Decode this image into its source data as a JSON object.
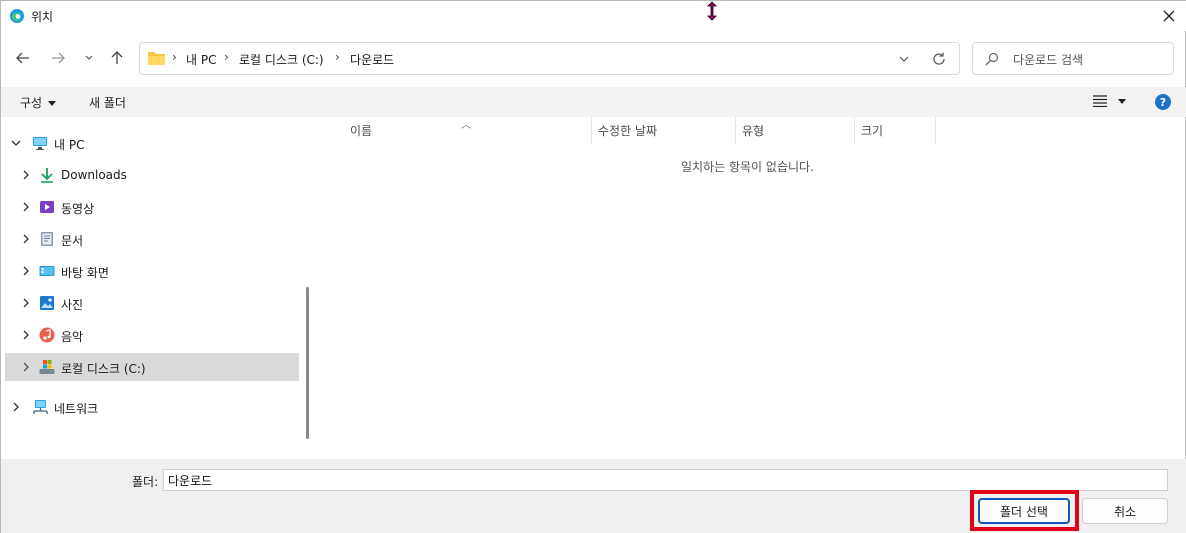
{
  "window": {
    "title": "위치",
    "close_glyph": "✕"
  },
  "toolbar": {
    "back_icon": "arrow-left-icon",
    "forward_icon": "arrow-right-icon",
    "recent_icon": "chevron-down-icon",
    "up_icon": "arrow-up-icon"
  },
  "address": {
    "crumbs": [
      "내 PC",
      "로컬 디스크 (C:)",
      "다운로드"
    ],
    "separator": "›"
  },
  "search": {
    "placeholder": "다운로드 검색"
  },
  "commandbar": {
    "organize_label": "구성",
    "new_folder_label": "새 폴더",
    "help_glyph": "?"
  },
  "navpane": {
    "items": [
      {
        "label": "내 PC",
        "icon": "pc-icon"
      },
      {
        "label": "Downloads",
        "icon": "download-icon"
      },
      {
        "label": "동영상",
        "icon": "video-icon"
      },
      {
        "label": "문서",
        "icon": "document-icon"
      },
      {
        "label": "바탕 화면",
        "icon": "desktop-icon"
      },
      {
        "label": "사진",
        "icon": "picture-icon"
      },
      {
        "label": "음악",
        "icon": "music-icon"
      },
      {
        "label": "로컬 디스크 (C:)",
        "icon": "drive-icon"
      },
      {
        "label": "네트워크",
        "icon": "network-icon"
      }
    ],
    "selected_index": 7
  },
  "content": {
    "columns": [
      "이름",
      "수정한 날짜",
      "유형",
      "크기"
    ],
    "empty_message": "일치하는 항목이 없습니다."
  },
  "footer": {
    "folder_label": "폴더:",
    "folder_value": "다운로드",
    "select_button": "폴더 선택",
    "cancel_button": "취소"
  },
  "colors": {
    "accent": "#1059b8",
    "highlight": "#e2001a",
    "selection": "#d9d9d9"
  }
}
